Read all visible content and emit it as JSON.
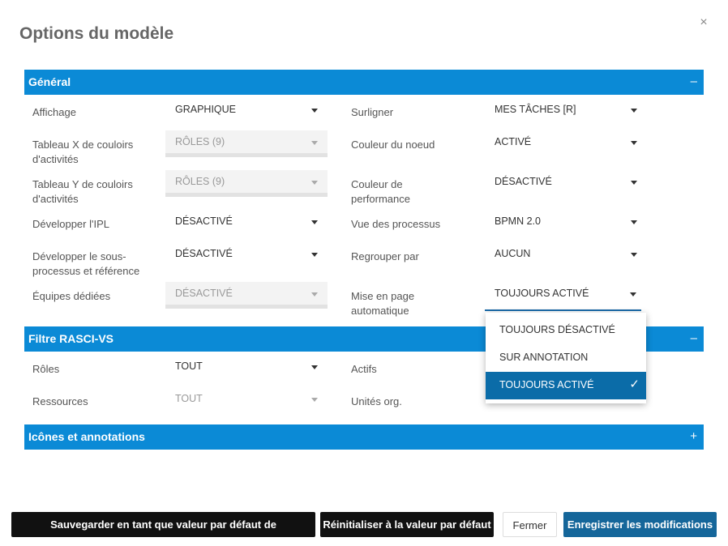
{
  "dialog": {
    "title": "Options du modèle",
    "close": "×"
  },
  "sections": {
    "general": {
      "title": "Général",
      "toggle": "–"
    },
    "rasci": {
      "title": "Filtre RASCI-VS",
      "toggle": "–"
    },
    "icons": {
      "title": "Icônes et annotations",
      "toggle": "+"
    }
  },
  "general": {
    "affichage": {
      "label": "Affichage",
      "value": "GRAPHIQUE"
    },
    "tableau_x": {
      "label": "Tableau X de couloirs d'activités",
      "value": "RÔLES (9)"
    },
    "tableau_y": {
      "label": "Tableau Y de couloirs d'activités",
      "value": "RÔLES (9)"
    },
    "developper_ipl": {
      "label": "Développer l'IPL",
      "value": "DÉSACTIVÉ"
    },
    "developper_sous": {
      "label": "Développer le sous-processus et référence",
      "value": "DÉSACTIVÉ"
    },
    "equipes": {
      "label": "Équipes dédiées",
      "value": "DÉSACTIVÉ"
    },
    "surligner": {
      "label": "Surligner",
      "value": "MES TÂCHES [R]"
    },
    "couleur_noeud": {
      "label": "Couleur du noeud",
      "value": "ACTIVÉ"
    },
    "couleur_perf": {
      "label": "Couleur de performance",
      "value": "DÉSACTIVÉ"
    },
    "vue_processus": {
      "label": "Vue des processus",
      "value": "BPMN 2.0"
    },
    "regrouper": {
      "label": "Regrouper par",
      "value": "AUCUN"
    },
    "mise_en_page": {
      "label": "Mise en page automatique",
      "value": "TOUJOURS ACTIVÉ"
    }
  },
  "dropdown": {
    "options": [
      "TOUJOURS DÉSACTIVÉ",
      "SUR ANNOTATION",
      "TOUJOURS ACTIVÉ"
    ],
    "check": "✓"
  },
  "rasci": {
    "roles": {
      "label": "Rôles",
      "value": "TOUT"
    },
    "ressources": {
      "label": "Ressources",
      "value": "TOUT"
    },
    "actifs": {
      "label": "Actifs"
    },
    "unites": {
      "label": "Unités org."
    }
  },
  "footer": {
    "save_default": "Sauvegarder en tant que valeur par défaut de l'environnement",
    "reset": "Réinitialiser à la valeur par défaut",
    "close": "Fermer",
    "save": "Enregistrer les modifications"
  },
  "colors": {
    "accent": "#0b8ad6",
    "selected": "#0b6ca8",
    "primary_button": "#15669a"
  },
  "icons": {
    "close": "close-icon",
    "caret": "caret-down-icon",
    "check": "check-icon"
  }
}
